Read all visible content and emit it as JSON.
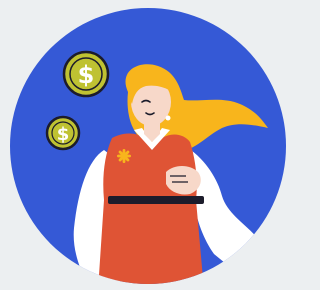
{
  "illustration": {
    "subject": "woman-with-coins",
    "colors": {
      "page_background": "#eceff1",
      "circle_background": "#3559d6",
      "hair": "#f8b51c",
      "skin": "#f7d8c9",
      "dress": "#df5435",
      "shirt": "#ffffff",
      "outline": "#1c1c2b",
      "belt": "#1c1c2b",
      "flower": "#f8b51c",
      "coin": "#bfc232",
      "coin_rim": "#1c1c2b",
      "coin_symbol": "#ffffff"
    },
    "coins": [
      {
        "symbol": "$",
        "size": "large"
      },
      {
        "symbol": "$",
        "size": "small"
      }
    ]
  }
}
